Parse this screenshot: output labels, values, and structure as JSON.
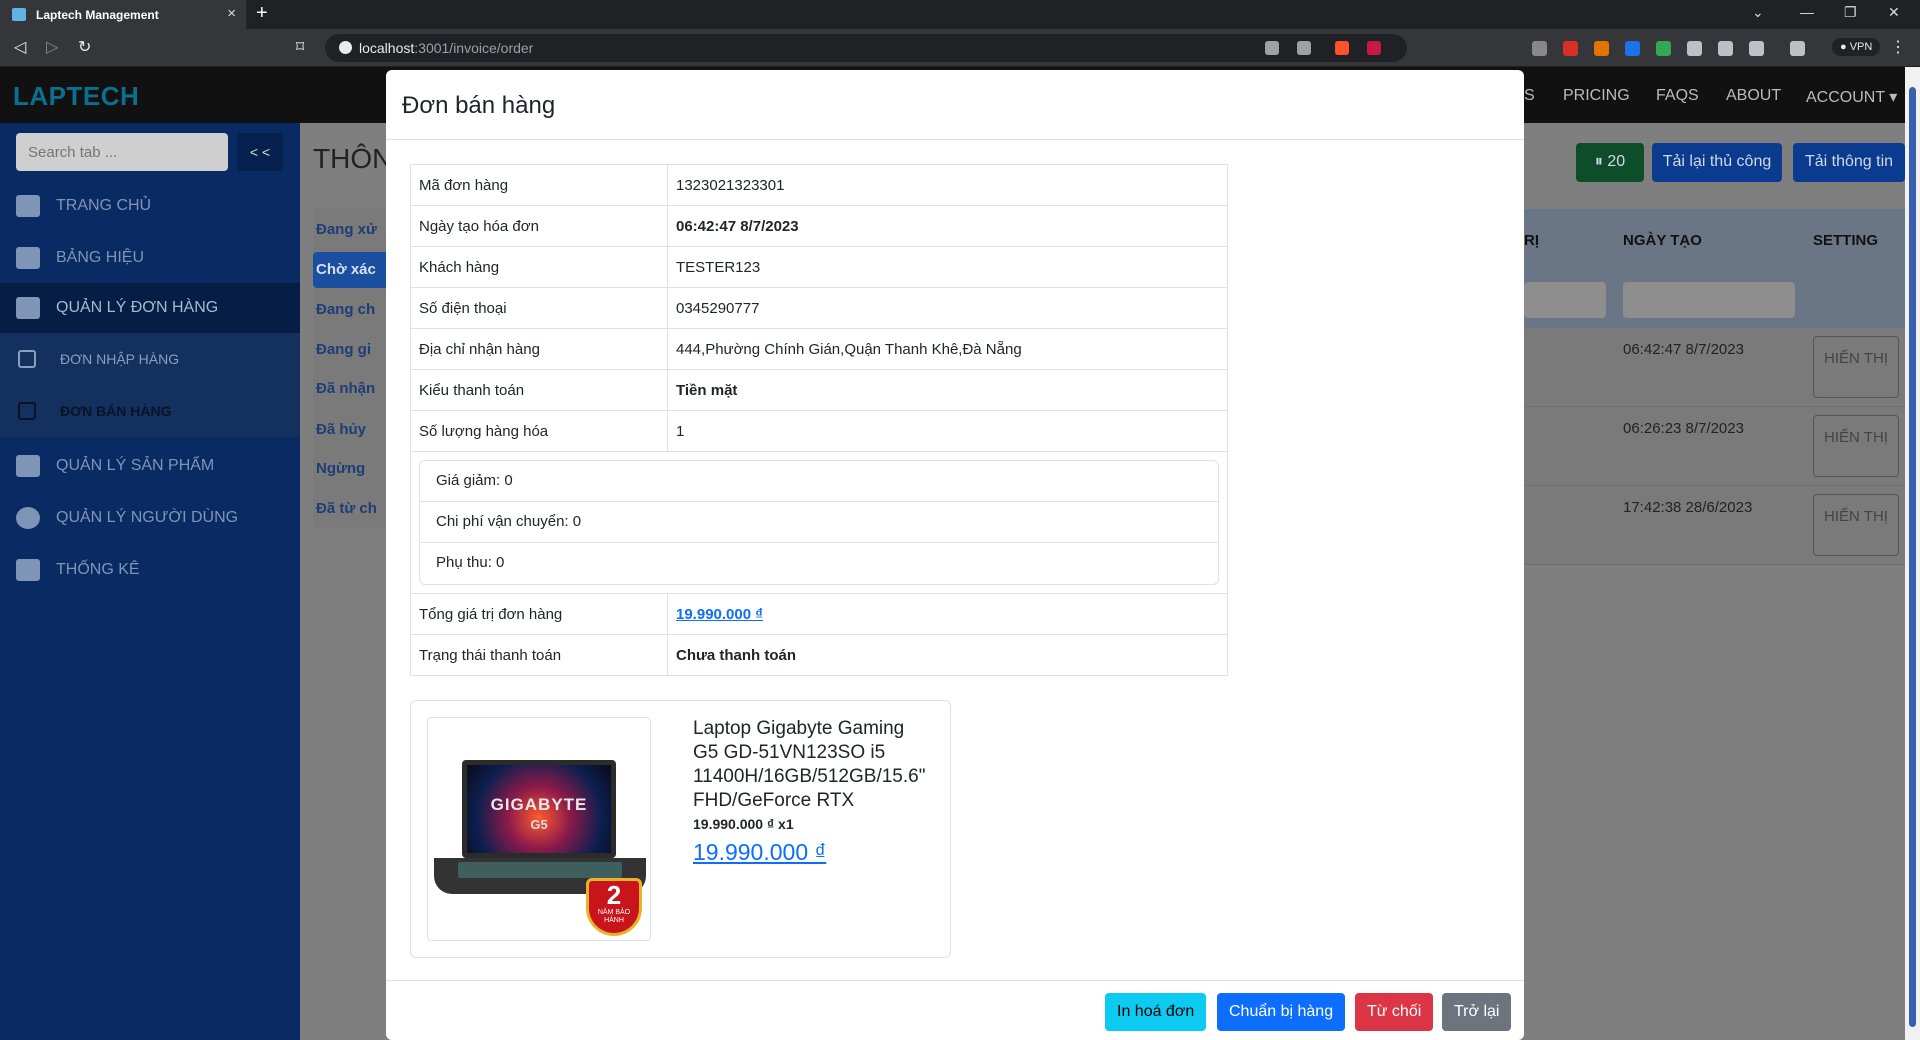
{
  "browser": {
    "tab_title": "Laptech Management",
    "new_tab": "+",
    "close": "×",
    "url_host": "localhost",
    "url_rest": ":3001/invoice/order",
    "vpn": "● VPN",
    "win_min": "—",
    "win_max": "❐",
    "win_close": "✕",
    "win_dropdown": "⌄"
  },
  "appnav": {
    "logo": "LAPTECH",
    "links": [
      "S",
      "PRICING",
      "FAQS",
      "ABOUT",
      "ACCOUNT ▾"
    ]
  },
  "sidebar": {
    "search_placeholder": "Search tab ...",
    "collapse_label": "< <",
    "items": [
      {
        "label": "TRANG CHỦ",
        "icon": "home-icon"
      },
      {
        "label": "BẢNG HIỆU",
        "icon": "ad-icon"
      },
      {
        "label": "QUẢN LÝ ĐƠN HÀNG",
        "icon": "table-icon"
      },
      {
        "label": "ĐƠN NHẬP HÀNG",
        "icon": "download-icon"
      },
      {
        "label": "ĐƠN BÁN HÀNG",
        "icon": "box-icon"
      },
      {
        "label": "QUẢN LÝ SẢN PHẨM",
        "icon": "grid-icon"
      },
      {
        "label": "QUẢN LÝ NGƯỜI DÙNG",
        "icon": "user-icon"
      },
      {
        "label": "THỐNG KÊ",
        "icon": "chart-icon"
      }
    ]
  },
  "page": {
    "title": "THÔN",
    "status_tabs": [
      "Đang xử",
      "Chờ xác",
      "Đang ch",
      "Đang gi",
      "Đã nhận",
      "Đã hủy",
      "Ngừng",
      "Đã từ ch"
    ],
    "timer_label": "20",
    "reload_label": "Tải lại thủ công",
    "reload_info_label": "Tải thông tin",
    "columns": [
      "RỊ",
      "NGÀY TẠO",
      "SETTING"
    ],
    "rows": [
      {
        "date": "06:42:47 8/7/2023",
        "action": "HIỂN THỊ"
      },
      {
        "date": "06:26:23 8/7/2023",
        "action": "HIỂN THỊ"
      },
      {
        "date": "17:42:38 28/6/2023",
        "action": "HIỂN THỊ"
      }
    ]
  },
  "modal": {
    "title": "Đơn bán hàng",
    "fields": {
      "order_id_label": "Mã đơn hàng",
      "order_id": "1323021323301",
      "created_label": "Ngày tạo hóa đơn",
      "created": "06:42:47 8/7/2023",
      "customer_label": "Khách hàng",
      "customer": "TESTER123",
      "phone_label": "Số điện thoại",
      "phone": "0345290777",
      "address_label": "Địa chỉ nhận hàng",
      "address": "444,Phường Chính Gián,Quận Thanh Khê,Đà Nẵng",
      "payment_type_label": "Kiểu thanh toán",
      "payment_type": "Tiền mặt",
      "qty_label": "Số lượng hàng hóa",
      "qty": "1",
      "discount": "Giá giảm: 0",
      "shipping": "Chi phí vận chuyển: 0",
      "surcharge": "Phụ thu: 0",
      "total_label": "Tổng giá trị đơn hàng",
      "total": "19.990.000 ₫",
      "payment_status_label": "Trạng thái thanh toán",
      "payment_status": "Chưa thanh toán"
    },
    "product": {
      "name": "Laptop Gigabyte Gaming G5 GD-51VN123SO i5 11400H/16GB/512GB/15.6\" FHD/GeForce RTX",
      "unit_line": "19.990.000 ₫ x1",
      "price": "19.990.000 ₫",
      "image_brand": "GIGABYTE",
      "image_model": "G5",
      "badge_number": "2",
      "badge_text": "NĂM BẢO HÀNH"
    },
    "buttons": {
      "print": "In hoá đơn",
      "prepare": "Chuẩn bị hàng",
      "reject": "Từ chối",
      "back": "Trở lại"
    }
  },
  "colors": {
    "sidebar": "#0a2a63",
    "primary": "#0d6efd",
    "info": "#0dcaf0",
    "danger": "#dc3545",
    "secondary": "#6c757d"
  }
}
